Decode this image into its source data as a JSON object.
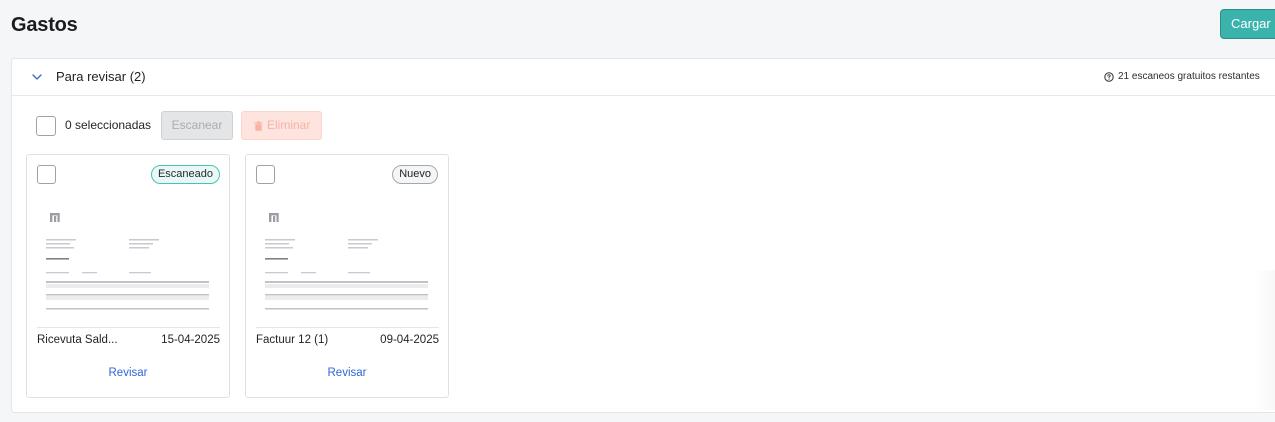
{
  "page": {
    "title": "Gastos",
    "upload_label": "Cargar"
  },
  "section": {
    "title": "Para revisar (2)",
    "scans_info": "21 escaneos gratuitos restantes",
    "toolbar": {
      "selected_count": "0 seleccionadas",
      "scan_label": "Escanear",
      "delete_label": "Eliminar"
    }
  },
  "cards": [
    {
      "name": "Ricevuta Sald...",
      "date": "15-04-2025",
      "status": "Escaneado",
      "action": "Revisar"
    },
    {
      "name": "Factuur 12 (1)",
      "date": "09-04-2025",
      "status": "Nuevo",
      "action": "Revisar"
    }
  ],
  "colors": {
    "accent": "#3bb3ad",
    "link": "#2f67d8",
    "danger_light": "#fde4df",
    "badge_scanned_border": "#4cc0b3"
  },
  "icons": [
    "chevron-down-icon",
    "help-circle-icon",
    "trash-icon",
    "document-preview-icon"
  ]
}
